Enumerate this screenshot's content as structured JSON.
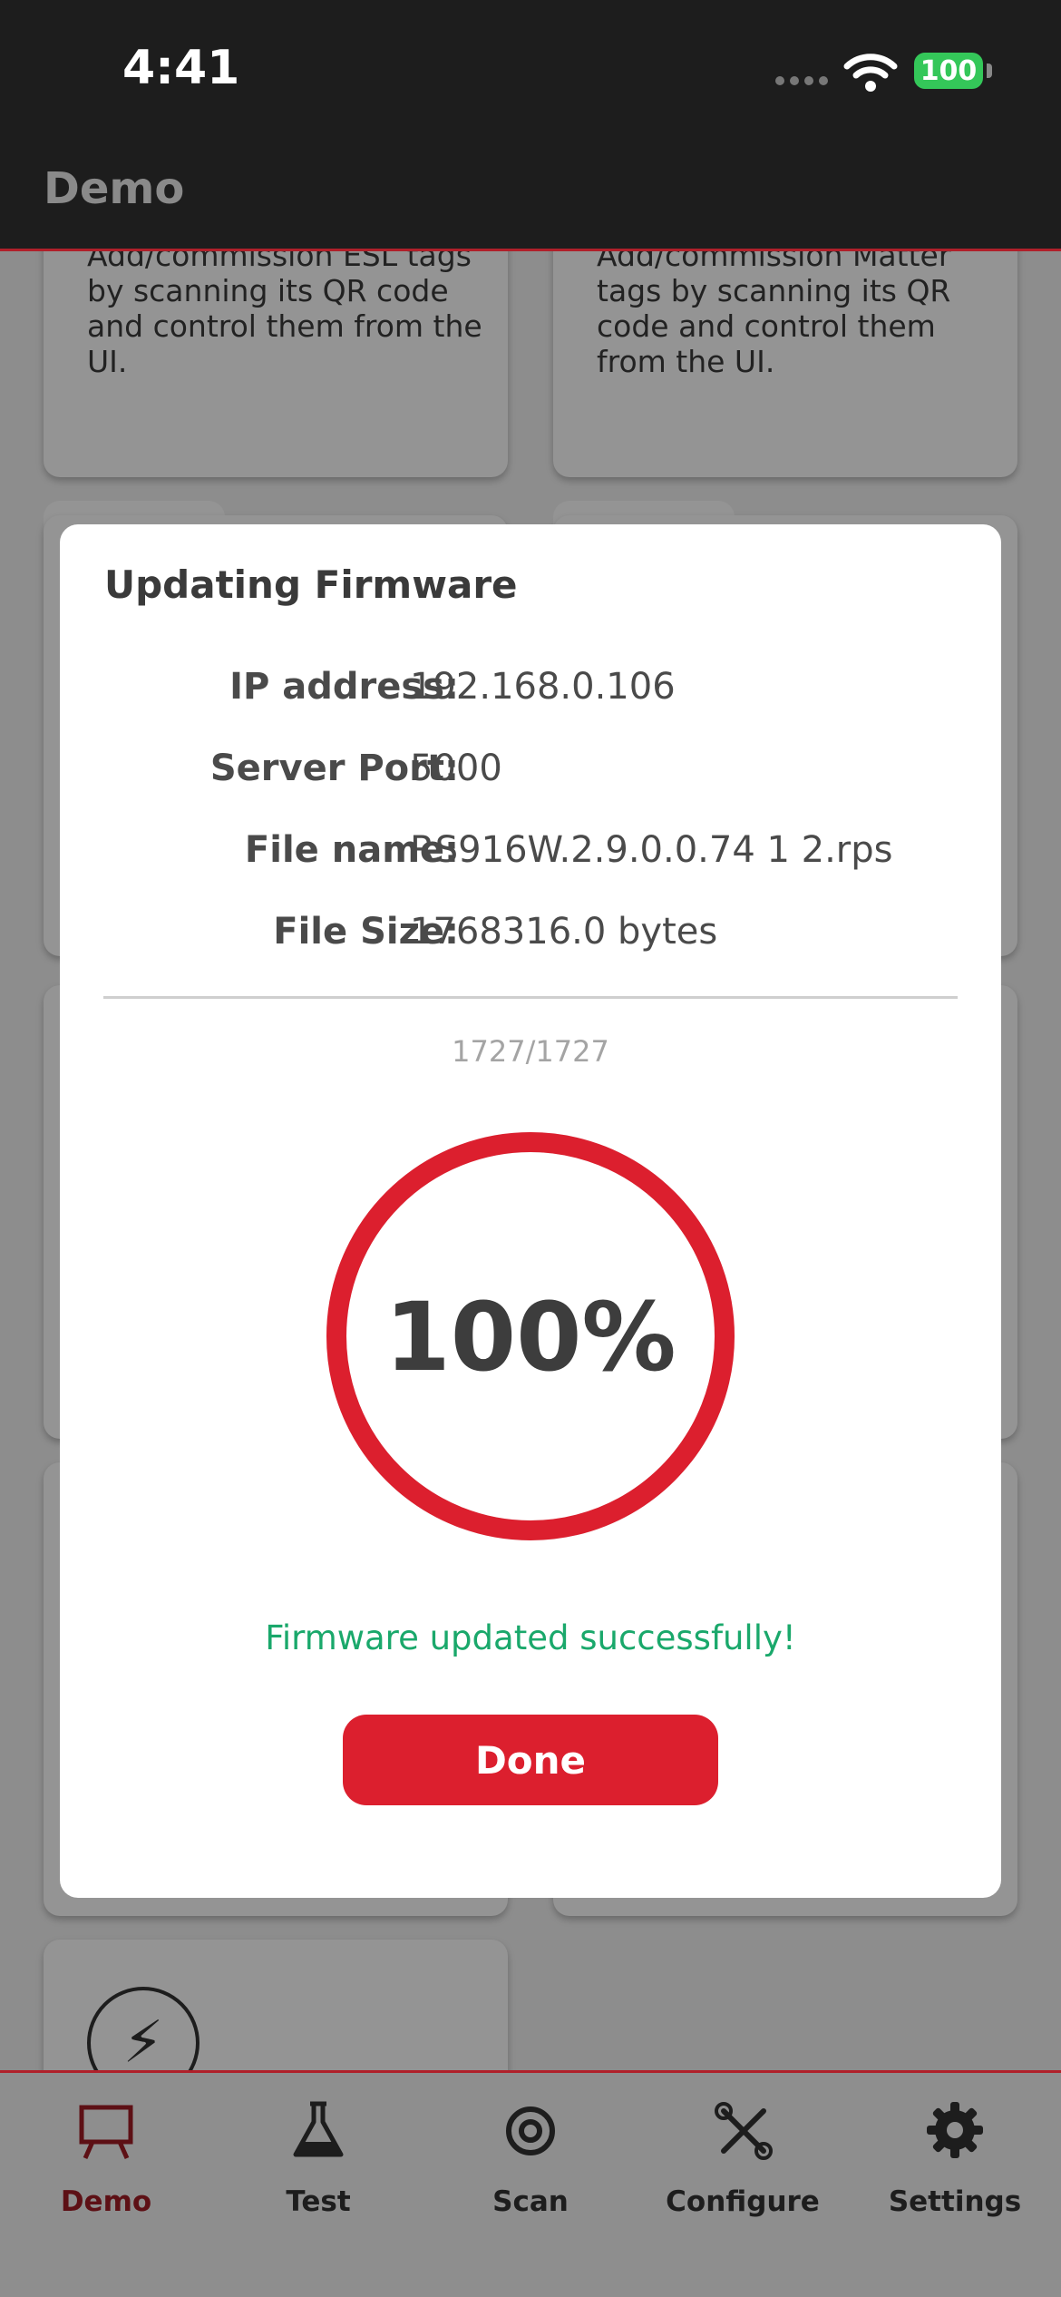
{
  "status_bar": {
    "time": "4:41",
    "battery": "100"
  },
  "nav": {
    "title": "Demo"
  },
  "background_cards": [
    {
      "text": "Add/commission ESL tags by scanning its QR code and control them from the UI."
    },
    {
      "text": "Add/commission Matter tags by scanning its QR code and control them from the UI."
    }
  ],
  "dialog": {
    "title": "Updating Firmware",
    "info": [
      {
        "label": "IP address:",
        "value": "192.168.0.106"
      },
      {
        "label": "Server Port:",
        "value": "5000"
      },
      {
        "label": "File name:",
        "value": "RS916W.2.9.0.0.74 1 2.rps"
      },
      {
        "label": "File Size:",
        "value": "1768316.0 bytes"
      }
    ],
    "counter": "1727/1727",
    "progress_fraction": 1.0,
    "percent_label": "100%",
    "status_message": "Firmware updated successfully!",
    "done_label": "Done"
  },
  "tabs": [
    {
      "label": "Demo",
      "icon": "easel-icon",
      "active": true
    },
    {
      "label": "Test",
      "icon": "flask-icon",
      "active": false
    },
    {
      "label": "Scan",
      "icon": "scan-at-icon",
      "active": false
    },
    {
      "label": "Configure",
      "icon": "tools-icon",
      "active": false
    },
    {
      "label": "Settings",
      "icon": "gear-icon",
      "active": false
    }
  ],
  "colors": {
    "accent": "#dc1f2e",
    "success": "#1aa86b",
    "active_tab": "#a11d25"
  }
}
